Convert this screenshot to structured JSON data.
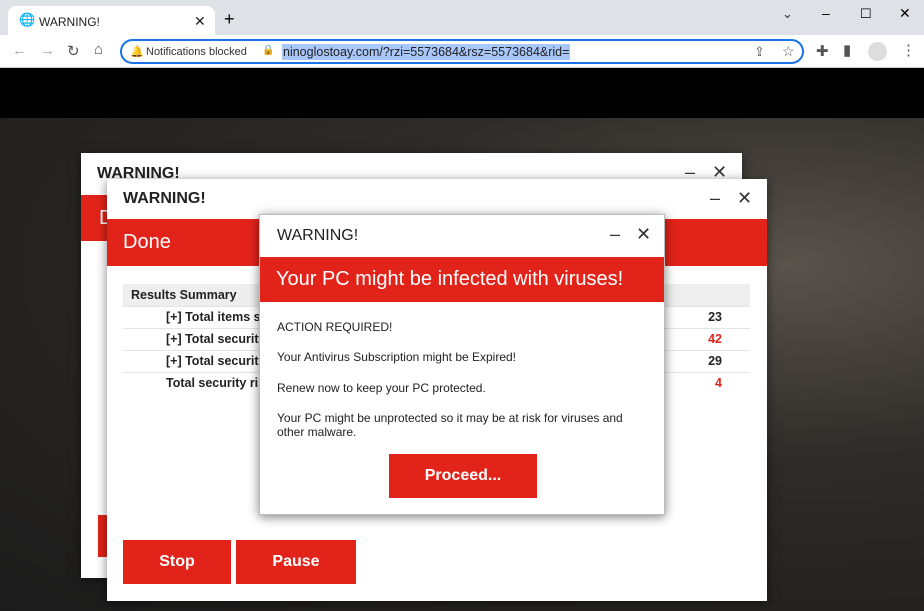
{
  "browser": {
    "tab_title": "WARNING!",
    "notifications": "Notifications blocked",
    "url": "ninoglostoay.com/?rzi=5573684&rsz=5573684&rid="
  },
  "back_window": {
    "title": "WARNING!",
    "band_letter": "D"
  },
  "middle_window": {
    "title": "WARNING!",
    "band": "Done",
    "table_header": "Results Summary",
    "rows": [
      {
        "label": "[+] Total items sc",
        "value": "23",
        "alert": false
      },
      {
        "label": "[+] Total security",
        "value": "42",
        "alert": true
      },
      {
        "label": "[+] Total security",
        "value": "29",
        "alert": false
      },
      {
        "label": "Total security ris",
        "value": "4",
        "alert": true
      }
    ],
    "stop": "Stop",
    "pause": "Pause"
  },
  "dialog": {
    "title": "WARNING!",
    "headline": "Your PC might be infected with viruses!",
    "lines": [
      "ACTION REQUIRED!",
      "Your Antivirus Subscription might be Expired!",
      "Renew now to keep your PC protected.",
      "Your PC might be unprotected so it may be at risk for viruses and other malware."
    ],
    "button": "Proceed..."
  },
  "colors": {
    "accent": "#e2231a",
    "alert_text": "#e2231a"
  }
}
